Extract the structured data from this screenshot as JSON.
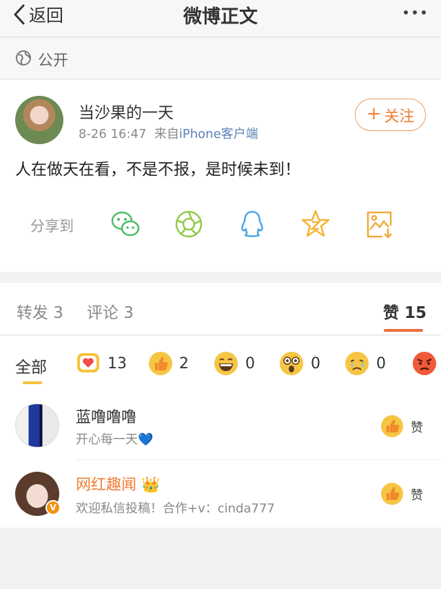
{
  "nav": {
    "back_label": "返回",
    "title": "微博正文"
  },
  "visibility": {
    "label": "公开"
  },
  "post": {
    "author": "当沙果的一天",
    "time": "8-26 16:47",
    "source_prefix": "来自",
    "source_app": "iPhone客户端",
    "follow_label": "关注",
    "text": "人在做天在看，不是不报，是时候未到！",
    "share_label": "分享到",
    "share_targets": [
      "wechat-icon",
      "moments-icon",
      "qq-icon",
      "favorite-icon",
      "save-image-icon"
    ]
  },
  "tabs": {
    "repost": "转发 3",
    "comment": "评论 3",
    "like_label": "赞",
    "like_count": "15",
    "accent": "#ee6d3a"
  },
  "reactions": {
    "all_label": "全部",
    "items": [
      {
        "icon": "heart-card-icon",
        "count": "13"
      },
      {
        "icon": "thumbs-up-icon",
        "count": "2"
      },
      {
        "icon": "laugh-icon",
        "count": "0"
      },
      {
        "icon": "surprised-icon",
        "count": "0"
      },
      {
        "icon": "sad-icon",
        "count": "0"
      },
      {
        "icon": "angry-icon",
        "count": ""
      }
    ]
  },
  "likers": [
    {
      "name": "蓝噜噜噜",
      "desc": "开心每一天💙",
      "like_label": "赞"
    },
    {
      "name": "网红趣闻",
      "name_badge": "👑",
      "verified": "V",
      "desc": "欢迎私信投稿！合作+v：cinda777",
      "like_label": "赞"
    }
  ]
}
